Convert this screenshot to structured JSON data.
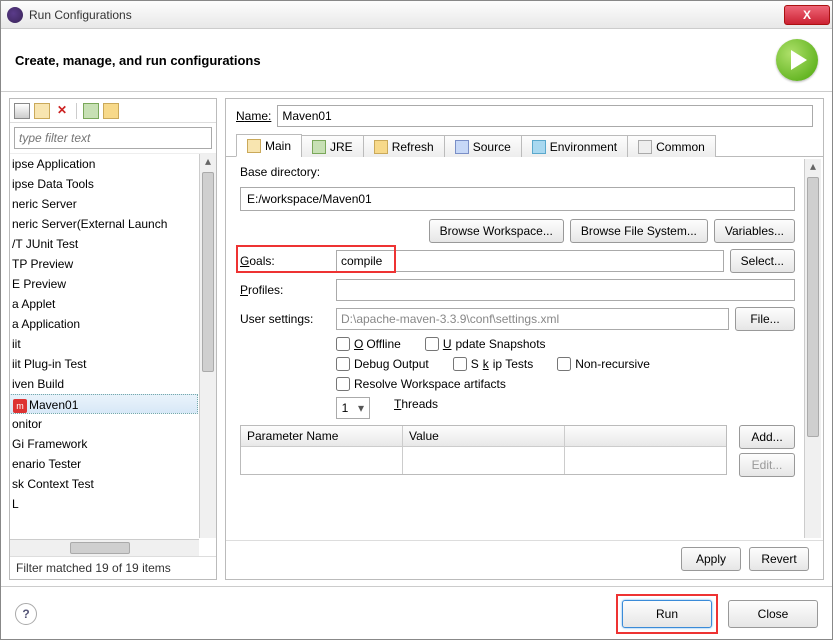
{
  "window": {
    "title": "Run Configurations",
    "close_x": "X"
  },
  "header": {
    "title": "Create, manage, and run configurations"
  },
  "left": {
    "filter_placeholder": "type filter text",
    "items": [
      "ipse Application",
      "ipse Data Tools",
      "neric Server",
      "neric Server(External Launch",
      "/T JUnit Test",
      "TP Preview",
      "E Preview",
      "a Applet",
      "a Application",
      "iit",
      "iit Plug-in Test",
      "iven Build",
      "Maven01",
      "onitor",
      "Gi Framework",
      "enario Tester",
      "sk Context Test",
      "L"
    ],
    "selected_index": 12,
    "footer": "Filter matched 19 of 19 items"
  },
  "name": {
    "label": "Name:",
    "value": "Maven01"
  },
  "tabs": [
    {
      "label": "Main",
      "icon": "ti-main"
    },
    {
      "label": "JRE",
      "icon": "ti-jre"
    },
    {
      "label": "Refresh",
      "icon": "ti-ref"
    },
    {
      "label": "Source",
      "icon": "ti-src"
    },
    {
      "label": "Environment",
      "icon": "ti-env"
    },
    {
      "label": "Common",
      "icon": "ti-com"
    }
  ],
  "main": {
    "base_dir_label": "Base directory:",
    "base_dir": "E:/workspace/Maven01",
    "browse_ws": "Browse Workspace...",
    "browse_fs": "Browse File System...",
    "variables": "Variables...",
    "goals_label": "Goals:",
    "goals": "compile",
    "select": "Select...",
    "profiles_label": "Profiles:",
    "profiles": "",
    "user_settings_label": "User settings:",
    "user_settings": "D:\\apache-maven-3.3.9\\conf\\settings.xml",
    "file": "File...",
    "offline": "Offline",
    "update_snapshots": "Update Snapshots",
    "debug_output": "Debug Output",
    "skip_tests": "Skip Tests",
    "non_recursive": "Non-recursive",
    "resolve_ws": "Resolve Workspace artifacts",
    "threads_label": "Threads",
    "threads": "1",
    "param_table": {
      "h1": "Parameter Name",
      "h2": "Value"
    },
    "add": "Add...",
    "edit": "Edit..."
  },
  "buttons": {
    "apply": "Apply",
    "revert": "Revert",
    "run": "Run",
    "close": "Close",
    "help": "?"
  }
}
